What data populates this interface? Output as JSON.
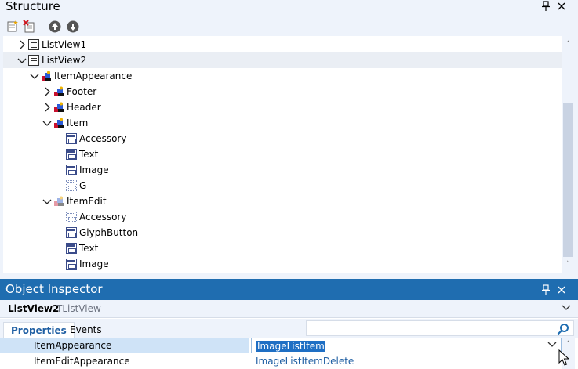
{
  "structure": {
    "title": "Structure",
    "pin_glyph": "⮌",
    "close_glyph": "✕",
    "toolbar": {
      "buttons": [
        {
          "name": "add-item-icon"
        },
        {
          "name": "delete-item-icon"
        },
        {
          "name": "move-up-icon"
        },
        {
          "name": "move-down-icon"
        }
      ]
    },
    "tree": [
      {
        "label": "ListView1",
        "level": 0,
        "expander": "collapsed",
        "icon": "list-icon"
      },
      {
        "label": "ListView2",
        "level": 0,
        "expander": "expanded",
        "icon": "list-icon",
        "selected": true
      },
      {
        "label": "ItemAppearance",
        "level": 1,
        "expander": "expanded",
        "icon": "appearance-icon"
      },
      {
        "label": "Footer",
        "level": 2,
        "expander": "collapsed",
        "icon": "appearance-icon"
      },
      {
        "label": "Header",
        "level": 2,
        "expander": "collapsed",
        "icon": "appearance-icon"
      },
      {
        "label": "Item",
        "level": 2,
        "expander": "expanded",
        "icon": "appearance-icon"
      },
      {
        "label": "Accessory",
        "level": 3,
        "expander": "none",
        "icon": "component-icon"
      },
      {
        "label": "Text",
        "level": 3,
        "expander": "none",
        "icon": "component-icon"
      },
      {
        "label": "Image",
        "level": 3,
        "expander": "none",
        "icon": "component-icon"
      },
      {
        "label": "G",
        "level": 3,
        "expander": "none",
        "icon": "component-dotted-icon"
      },
      {
        "label": "ItemEdit",
        "level": 2,
        "expander": "expanded",
        "icon": "appearance-dim-icon"
      },
      {
        "label": "Accessory",
        "level": 3,
        "expander": "none",
        "icon": "component-dotted-icon"
      },
      {
        "label": "GlyphButton",
        "level": 3,
        "expander": "none",
        "icon": "component-icon"
      },
      {
        "label": "Text",
        "level": 3,
        "expander": "none",
        "icon": "component-icon"
      },
      {
        "label": "Image",
        "level": 3,
        "expander": "none",
        "icon": "component-icon"
      }
    ]
  },
  "inspector": {
    "title": "Object Inspector",
    "object_name": "ListView2",
    "object_type": "TListView",
    "tabs": [
      {
        "label": "Properties",
        "active": true
      },
      {
        "label": "Events",
        "active": false
      }
    ],
    "search_placeholder": "",
    "properties": [
      {
        "name": "ItemAppearance",
        "value": "ImageListItem",
        "selected": true
      },
      {
        "name": "ItemEditAppearance",
        "value": "ImageListItemDelete",
        "selected": false
      }
    ]
  },
  "colors": {
    "accent": "#1f6db0",
    "panel_bg": "#eef3fb",
    "value_text": "#1f5fa3",
    "selection": "#1f6fc4"
  }
}
